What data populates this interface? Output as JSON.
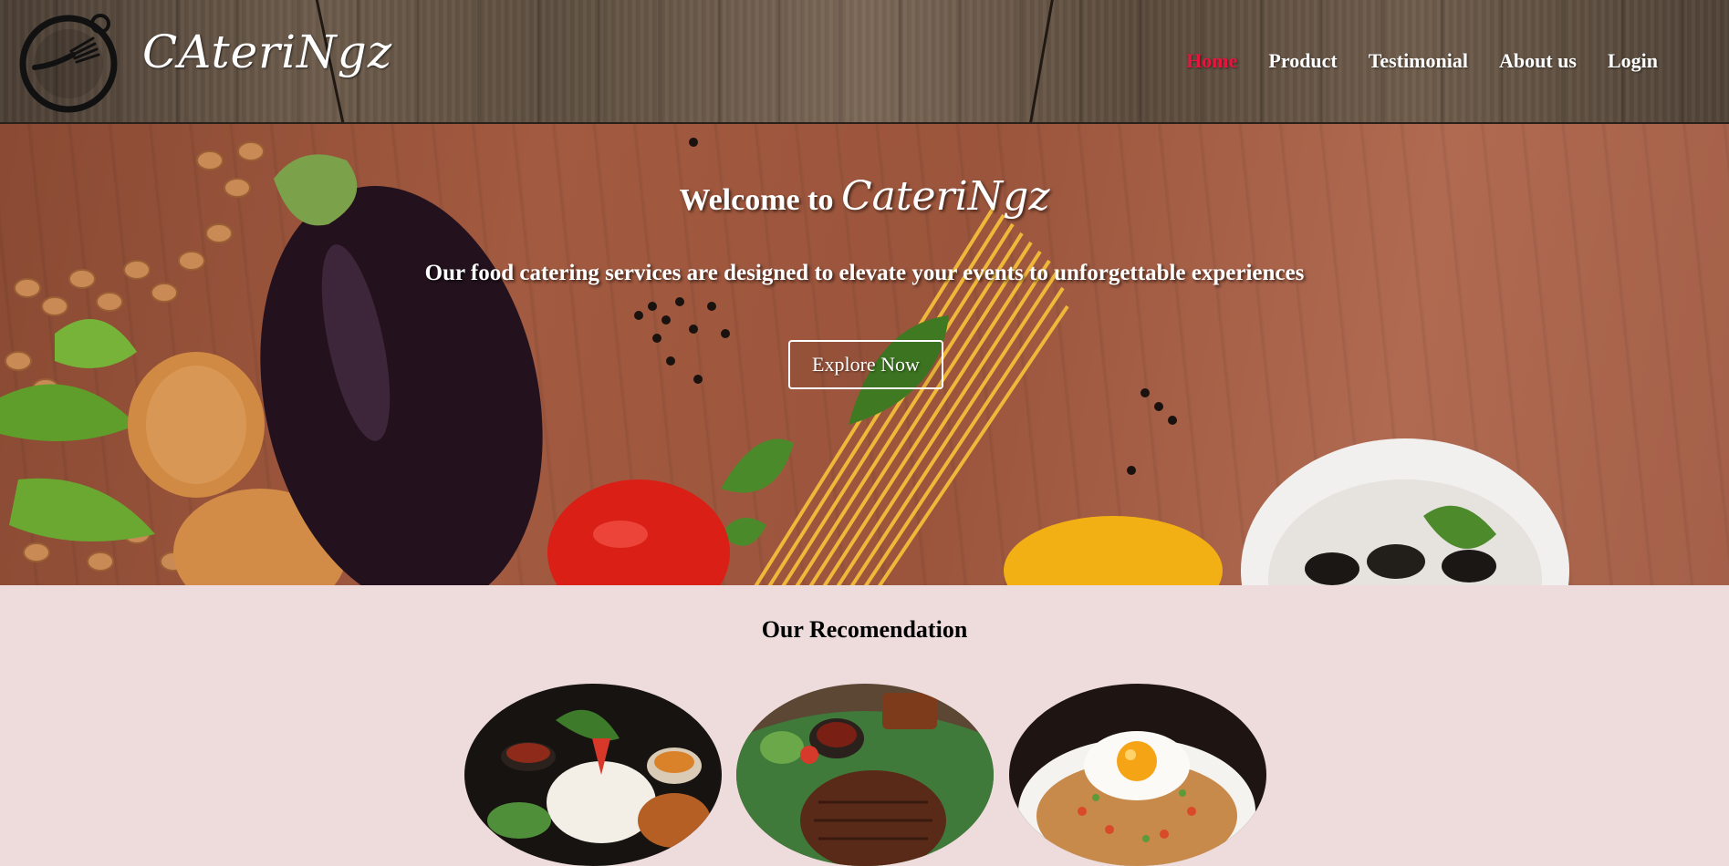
{
  "header": {
    "logo_text": "CAteriNgz",
    "nav": [
      {
        "label": "Home",
        "active": true
      },
      {
        "label": "Product",
        "active": false
      },
      {
        "label": "Testimonial",
        "active": false
      },
      {
        "label": "About us",
        "active": false
      },
      {
        "label": "Login",
        "active": false
      }
    ]
  },
  "hero": {
    "title_prefix": "Welcome to",
    "title_brand": "CateriNgz",
    "subtitle": "Our food catering services are designed to elevate your events to unforgettable experiences",
    "cta_label": "Explore Now"
  },
  "recommendation": {
    "title": "Our Recomendation",
    "dishes": [
      {
        "icon": "rice-platter-image"
      },
      {
        "icon": "grilled-meat-image"
      },
      {
        "icon": "fried-rice-egg-image"
      }
    ]
  },
  "colors": {
    "nav_active": "#e3163e",
    "nav_text": "#ffffff",
    "page_bg": "#eedcdc"
  }
}
